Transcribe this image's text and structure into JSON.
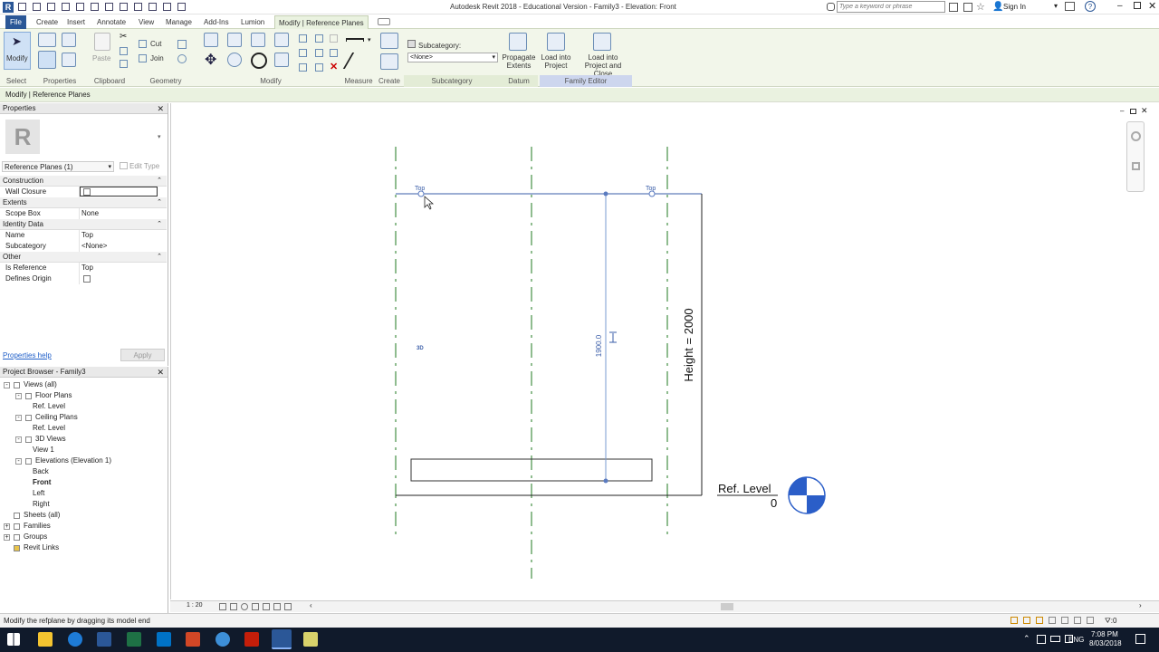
{
  "titlebar": {
    "title": "Autodesk Revit 2018 - Educational Version -    Family3 - Elevation: Front",
    "search_placeholder": "Type a keyword or phrase",
    "sign_in": "Sign In"
  },
  "tabs": [
    "File",
    "Create",
    "Insert",
    "Annotate",
    "View",
    "Manage",
    "Add-Ins",
    "Lumion",
    "Modify | Reference Planes"
  ],
  "ribbon": {
    "modify": "Modify",
    "paste": "Paste",
    "cut": "Cut",
    "join": "Join",
    "subcategory_label": "Subcategory:",
    "subcategory_value": "<None>",
    "propagate": "Propagate\nExtents",
    "load_into_project": "Load into\nProject",
    "load_close": "Load into\nProject and Close",
    "groups": {
      "select": "Select",
      "properties": "Properties",
      "clipboard": "Clipboard",
      "geometry": "Geometry",
      "modify": "Modify",
      "measure": "Measure",
      "create": "Create",
      "subcategory": "Subcategory",
      "datum": "Datum",
      "family_editor": "Family Editor"
    }
  },
  "context_bar": "Modify | Reference Planes",
  "properties": {
    "title": "Properties",
    "type_selector": "Reference Planes (1)",
    "edit_type": "Edit Type",
    "rows": [
      {
        "kind": "section",
        "label": "Construction"
      },
      {
        "kind": "check",
        "label": "Wall Closure",
        "value": ""
      },
      {
        "kind": "section",
        "label": "Extents"
      },
      {
        "kind": "text",
        "label": "Scope Box",
        "value": "None"
      },
      {
        "kind": "section",
        "label": "Identity Data"
      },
      {
        "kind": "text",
        "label": "Name",
        "value": "Top"
      },
      {
        "kind": "text",
        "label": "Subcategory",
        "value": "<None>"
      },
      {
        "kind": "section",
        "label": "Other"
      },
      {
        "kind": "text",
        "label": "Is Reference",
        "value": "Top"
      },
      {
        "kind": "check",
        "label": "Defines Origin",
        "value": ""
      }
    ],
    "help_link": "Properties help",
    "apply": "Apply"
  },
  "browser": {
    "title": "Project Browser - Family3",
    "items": [
      {
        "label": "Views (all)",
        "level": 0,
        "toggle": "-"
      },
      {
        "label": "Floor Plans",
        "level": 1,
        "toggle": "-"
      },
      {
        "label": "Ref. Level",
        "level": 2,
        "toggle": ""
      },
      {
        "label": "Ceiling Plans",
        "level": 1,
        "toggle": "-"
      },
      {
        "label": "Ref. Level",
        "level": 2,
        "toggle": ""
      },
      {
        "label": "3D Views",
        "level": 1,
        "toggle": "-"
      },
      {
        "label": "View 1",
        "level": 2,
        "toggle": ""
      },
      {
        "label": "Elevations (Elevation 1)",
        "level": 1,
        "toggle": "-"
      },
      {
        "label": "Back",
        "level": 2,
        "toggle": ""
      },
      {
        "label": "Front",
        "level": 2,
        "toggle": "",
        "bold": true
      },
      {
        "label": "Left",
        "level": 2,
        "toggle": ""
      },
      {
        "label": "Right",
        "level": 2,
        "toggle": ""
      },
      {
        "label": "Sheets (all)",
        "level": 0,
        "toggle": ""
      },
      {
        "label": "Families",
        "level": 0,
        "toggle": "+"
      },
      {
        "label": "Groups",
        "level": 0,
        "toggle": "+"
      },
      {
        "label": "Revit Links",
        "level": 0,
        "toggle": ""
      }
    ]
  },
  "canvas": {
    "plane_label_left": "Top",
    "plane_label_right": "Top",
    "label_3d": "3D",
    "dimension_value": "1900.0",
    "height_label": "Height = 2000",
    "level_name": "Ref. Level",
    "level_value": "0"
  },
  "viewbar": {
    "scale": "1 : 20"
  },
  "status_text": "Modify the refplane by dragging its model end",
  "taskbar": {
    "lang": "ENG",
    "time": "7:08 PM",
    "date": "8/03/2018",
    "filter": ":0"
  },
  "colors": {
    "ribbon_bg": "#f2f6ea",
    "accent_blue": "#2b5797",
    "refplane_green": "#1f7a1f",
    "taskbar_bg": "#101a2b"
  }
}
